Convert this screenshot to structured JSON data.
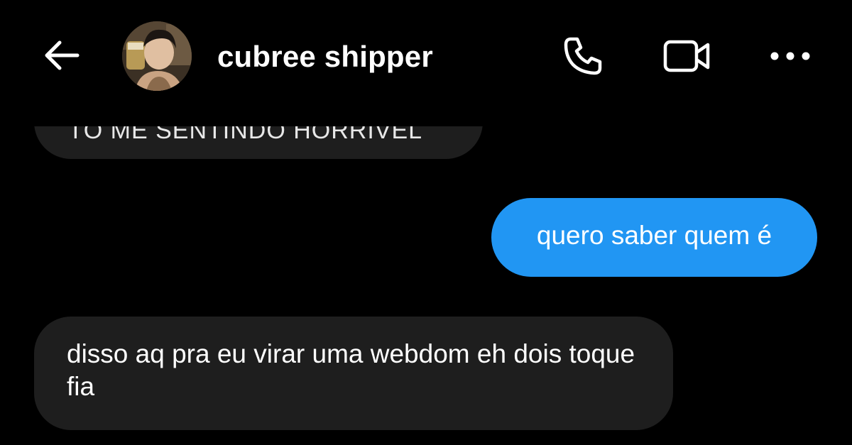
{
  "header": {
    "contact_name": "cubree shipper",
    "back_icon": "arrow-left-icon",
    "call_icon": "phone-icon",
    "video_icon": "video-camera-icon",
    "more_icon": "more-horizontal-icon"
  },
  "messages": [
    {
      "direction": "incoming",
      "text": "TÔ ME SENTINDO HORRÍVEL",
      "partially_visible": true
    },
    {
      "direction": "outgoing",
      "text": "quero saber quem é"
    },
    {
      "direction": "incoming",
      "text": "disso aq pra eu virar uma webdom eh dois toque fia"
    }
  ],
  "colors": {
    "background": "#000000",
    "incoming_bubble": "#1e1e1e",
    "outgoing_bubble": "#2196f3",
    "text": "#ffffff",
    "icon": "#ffffff"
  }
}
